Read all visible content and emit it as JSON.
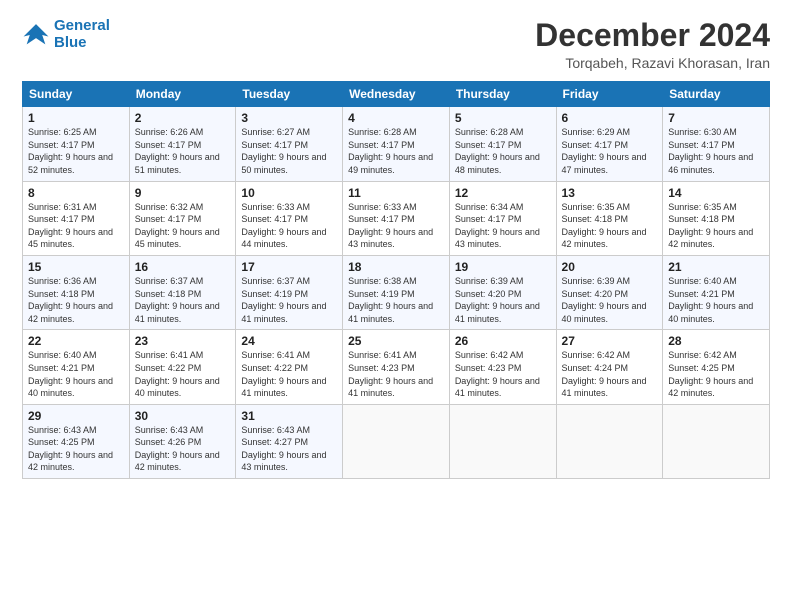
{
  "logo": {
    "line1": "General",
    "line2": "Blue"
  },
  "header": {
    "month": "December 2024",
    "location": "Torqabeh, Razavi Khorasan, Iran"
  },
  "weekdays": [
    "Sunday",
    "Monday",
    "Tuesday",
    "Wednesday",
    "Thursday",
    "Friday",
    "Saturday"
  ],
  "weeks": [
    [
      {
        "day": "1",
        "sunrise": "6:25 AM",
        "sunset": "4:17 PM",
        "daylight": "9 hours and 52 minutes."
      },
      {
        "day": "2",
        "sunrise": "6:26 AM",
        "sunset": "4:17 PM",
        "daylight": "9 hours and 51 minutes."
      },
      {
        "day": "3",
        "sunrise": "6:27 AM",
        "sunset": "4:17 PM",
        "daylight": "9 hours and 50 minutes."
      },
      {
        "day": "4",
        "sunrise": "6:28 AM",
        "sunset": "4:17 PM",
        "daylight": "9 hours and 49 minutes."
      },
      {
        "day": "5",
        "sunrise": "6:28 AM",
        "sunset": "4:17 PM",
        "daylight": "9 hours and 48 minutes."
      },
      {
        "day": "6",
        "sunrise": "6:29 AM",
        "sunset": "4:17 PM",
        "daylight": "9 hours and 47 minutes."
      },
      {
        "day": "7",
        "sunrise": "6:30 AM",
        "sunset": "4:17 PM",
        "daylight": "9 hours and 46 minutes."
      }
    ],
    [
      {
        "day": "8",
        "sunrise": "6:31 AM",
        "sunset": "4:17 PM",
        "daylight": "9 hours and 45 minutes."
      },
      {
        "day": "9",
        "sunrise": "6:32 AM",
        "sunset": "4:17 PM",
        "daylight": "9 hours and 45 minutes."
      },
      {
        "day": "10",
        "sunrise": "6:33 AM",
        "sunset": "4:17 PM",
        "daylight": "9 hours and 44 minutes."
      },
      {
        "day": "11",
        "sunrise": "6:33 AM",
        "sunset": "4:17 PM",
        "daylight": "9 hours and 43 minutes."
      },
      {
        "day": "12",
        "sunrise": "6:34 AM",
        "sunset": "4:17 PM",
        "daylight": "9 hours and 43 minutes."
      },
      {
        "day": "13",
        "sunrise": "6:35 AM",
        "sunset": "4:18 PM",
        "daylight": "9 hours and 42 minutes."
      },
      {
        "day": "14",
        "sunrise": "6:35 AM",
        "sunset": "4:18 PM",
        "daylight": "9 hours and 42 minutes."
      }
    ],
    [
      {
        "day": "15",
        "sunrise": "6:36 AM",
        "sunset": "4:18 PM",
        "daylight": "9 hours and 42 minutes."
      },
      {
        "day": "16",
        "sunrise": "6:37 AM",
        "sunset": "4:18 PM",
        "daylight": "9 hours and 41 minutes."
      },
      {
        "day": "17",
        "sunrise": "6:37 AM",
        "sunset": "4:19 PM",
        "daylight": "9 hours and 41 minutes."
      },
      {
        "day": "18",
        "sunrise": "6:38 AM",
        "sunset": "4:19 PM",
        "daylight": "9 hours and 41 minutes."
      },
      {
        "day": "19",
        "sunrise": "6:39 AM",
        "sunset": "4:20 PM",
        "daylight": "9 hours and 41 minutes."
      },
      {
        "day": "20",
        "sunrise": "6:39 AM",
        "sunset": "4:20 PM",
        "daylight": "9 hours and 40 minutes."
      },
      {
        "day": "21",
        "sunrise": "6:40 AM",
        "sunset": "4:21 PM",
        "daylight": "9 hours and 40 minutes."
      }
    ],
    [
      {
        "day": "22",
        "sunrise": "6:40 AM",
        "sunset": "4:21 PM",
        "daylight": "9 hours and 40 minutes."
      },
      {
        "day": "23",
        "sunrise": "6:41 AM",
        "sunset": "4:22 PM",
        "daylight": "9 hours and 40 minutes."
      },
      {
        "day": "24",
        "sunrise": "6:41 AM",
        "sunset": "4:22 PM",
        "daylight": "9 hours and 41 minutes."
      },
      {
        "day": "25",
        "sunrise": "6:41 AM",
        "sunset": "4:23 PM",
        "daylight": "9 hours and 41 minutes."
      },
      {
        "day": "26",
        "sunrise": "6:42 AM",
        "sunset": "4:23 PM",
        "daylight": "9 hours and 41 minutes."
      },
      {
        "day": "27",
        "sunrise": "6:42 AM",
        "sunset": "4:24 PM",
        "daylight": "9 hours and 41 minutes."
      },
      {
        "day": "28",
        "sunrise": "6:42 AM",
        "sunset": "4:25 PM",
        "daylight": "9 hours and 42 minutes."
      }
    ],
    [
      {
        "day": "29",
        "sunrise": "6:43 AM",
        "sunset": "4:25 PM",
        "daylight": "9 hours and 42 minutes."
      },
      {
        "day": "30",
        "sunrise": "6:43 AM",
        "sunset": "4:26 PM",
        "daylight": "9 hours and 42 minutes."
      },
      {
        "day": "31",
        "sunrise": "6:43 AM",
        "sunset": "4:27 PM",
        "daylight": "9 hours and 43 minutes."
      },
      null,
      null,
      null,
      null
    ]
  ],
  "labels": {
    "sunrise": "Sunrise:",
    "sunset": "Sunset:",
    "daylight": "Daylight:"
  }
}
